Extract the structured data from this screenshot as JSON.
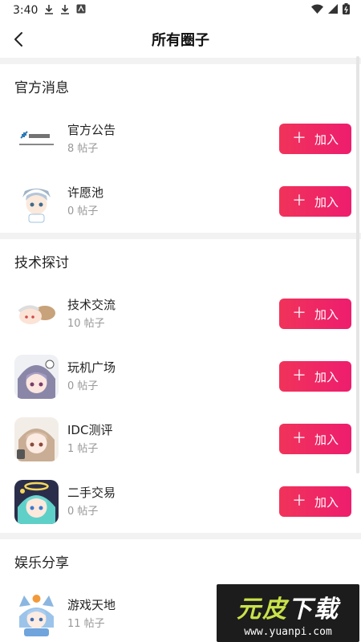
{
  "status_bar": {
    "time": "3:40"
  },
  "header": {
    "title": "所有圈子"
  },
  "sections": [
    {
      "title": "官方消息",
      "items": [
        {
          "name": "官方公告",
          "count": "8 帖子",
          "button": "加入"
        },
        {
          "name": "许愿池",
          "count": "0 帖子",
          "button": "加入"
        }
      ]
    },
    {
      "title": "技术探讨",
      "items": [
        {
          "name": "技术交流",
          "count": "10 帖子",
          "button": "加入"
        },
        {
          "name": "玩机广场",
          "count": "0 帖子",
          "button": "加入"
        },
        {
          "name": "IDC测评",
          "count": "1 帖子",
          "button": "加入"
        },
        {
          "name": "二手交易",
          "count": "0 帖子",
          "button": "加入"
        }
      ]
    },
    {
      "title": "娱乐分享",
      "items": [
        {
          "name": "游戏天地",
          "count": "11 帖子",
          "button": "加入"
        }
      ]
    }
  ],
  "watermark": {
    "main_a": "元",
    "main_b": "皮",
    "main_c": "下载",
    "sub": "www.yuanpi.com"
  },
  "theme": {
    "accent": "#ee1d6e"
  }
}
